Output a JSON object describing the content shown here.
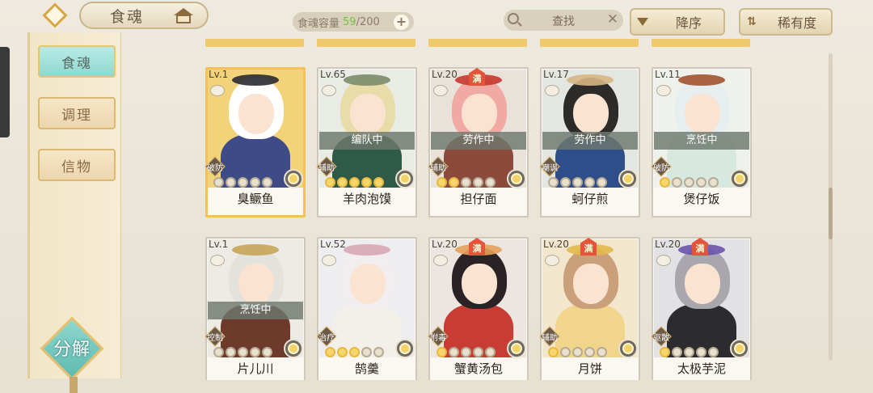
{
  "header": {
    "title": "食魂",
    "capacity_label": "食魂容量",
    "capacity_current": "59",
    "capacity_max": "/200",
    "capacity_add": "+",
    "search_placeholder": "查找",
    "search_clear": "✕",
    "sort_order": "降序",
    "sort_key": "稀有度"
  },
  "sidebar": {
    "tabs": [
      {
        "label": "食魂",
        "active": true
      },
      {
        "label": "调理",
        "active": false
      },
      {
        "label": "信物",
        "active": false
      }
    ],
    "decompose": "分解"
  },
  "cards": [
    {
      "level": "Lv.1",
      "name": "臭鳜鱼",
      "role": "破防",
      "status": "",
      "max": false,
      "stars": 0,
      "gold": true,
      "art": {
        "bg": "#f2d37a",
        "hair": "#ffffff",
        "accent": "#2a2a34",
        "body": "#3e4b86"
      }
    },
    {
      "level": "Lv.65",
      "name": "羊肉泡馍",
      "role": "辅助",
      "status": "编队中",
      "max": false,
      "stars": 5,
      "gold": false,
      "art": {
        "bg": "#e9ece4",
        "hair": "#e8dca8",
        "accent": "#7c8c6a",
        "body": "#2f5a48"
      }
    },
    {
      "level": "Lv.20",
      "name": "担仔面",
      "role": "辅助",
      "status": "劳作中",
      "max": true,
      "max_label": "满",
      "stars": 2,
      "gold": false,
      "art": {
        "bg": "#e8e2da",
        "hair": "#f1a9a3",
        "accent": "#c8372d",
        "body": "#8c4a3c"
      }
    },
    {
      "level": "Lv.17",
      "name": "蚵仔煎",
      "role": "嘲讽",
      "status": "劳作中",
      "max": false,
      "stars": 0,
      "gold": false,
      "art": {
        "bg": "#e4e6e2",
        "hair": "#2d2a2a",
        "accent": "#d6b784",
        "body": "#2f4d88"
      }
    },
    {
      "level": "Lv.11",
      "name": "煲仔饭",
      "role": "破防",
      "status": "烹饪中",
      "max": false,
      "stars": 1,
      "gold": false,
      "art": {
        "bg": "#eef1ec",
        "hair": "#e6eef0",
        "accent": "#a0522d",
        "body": "#d7e8df"
      }
    },
    {
      "level": "Lv.1",
      "name": "片儿川",
      "role": "控制",
      "status": "烹饪中",
      "max": false,
      "stars": 0,
      "gold": false,
      "art": {
        "bg": "#ecebe6",
        "hair": "#e4e2dc",
        "accent": "#c7a45a",
        "body": "#6e3a2c"
      }
    },
    {
      "level": "Lv.52",
      "name": "鹄羹",
      "role": "治疗",
      "status": "",
      "max": false,
      "stars": 3,
      "gold": false,
      "art": {
        "bg": "#eeeef0",
        "hair": "#f2eef0",
        "accent": "#d8a6b6",
        "body": "#f3f0ea"
      }
    },
    {
      "level": "Lv.20",
      "name": "蟹黄汤包",
      "role": "附毒",
      "status": "",
      "max": true,
      "max_label": "满",
      "stars": 1,
      "gold": false,
      "art": {
        "bg": "#ebe7e0",
        "hair": "#2a2326",
        "accent": "#e7a15a",
        "body": "#c83c34"
      }
    },
    {
      "level": "Lv.20",
      "name": "月饼",
      "role": "辅助",
      "status": "",
      "max": true,
      "max_label": "满",
      "stars": 1,
      "gold": false,
      "art": {
        "bg": "#f2e7cc",
        "hair": "#c9a07a",
        "accent": "#e2b84a",
        "body": "#f0d58a"
      }
    },
    {
      "level": "Lv.20",
      "name": "太极芋泥",
      "role": "驱散",
      "status": "",
      "max": true,
      "max_label": "满",
      "stars": 1,
      "gold": false,
      "art": {
        "bg": "#e2e1e3",
        "hair": "#a9a7ad",
        "accent": "#6c54a8",
        "body": "#2c2c30"
      }
    }
  ]
}
